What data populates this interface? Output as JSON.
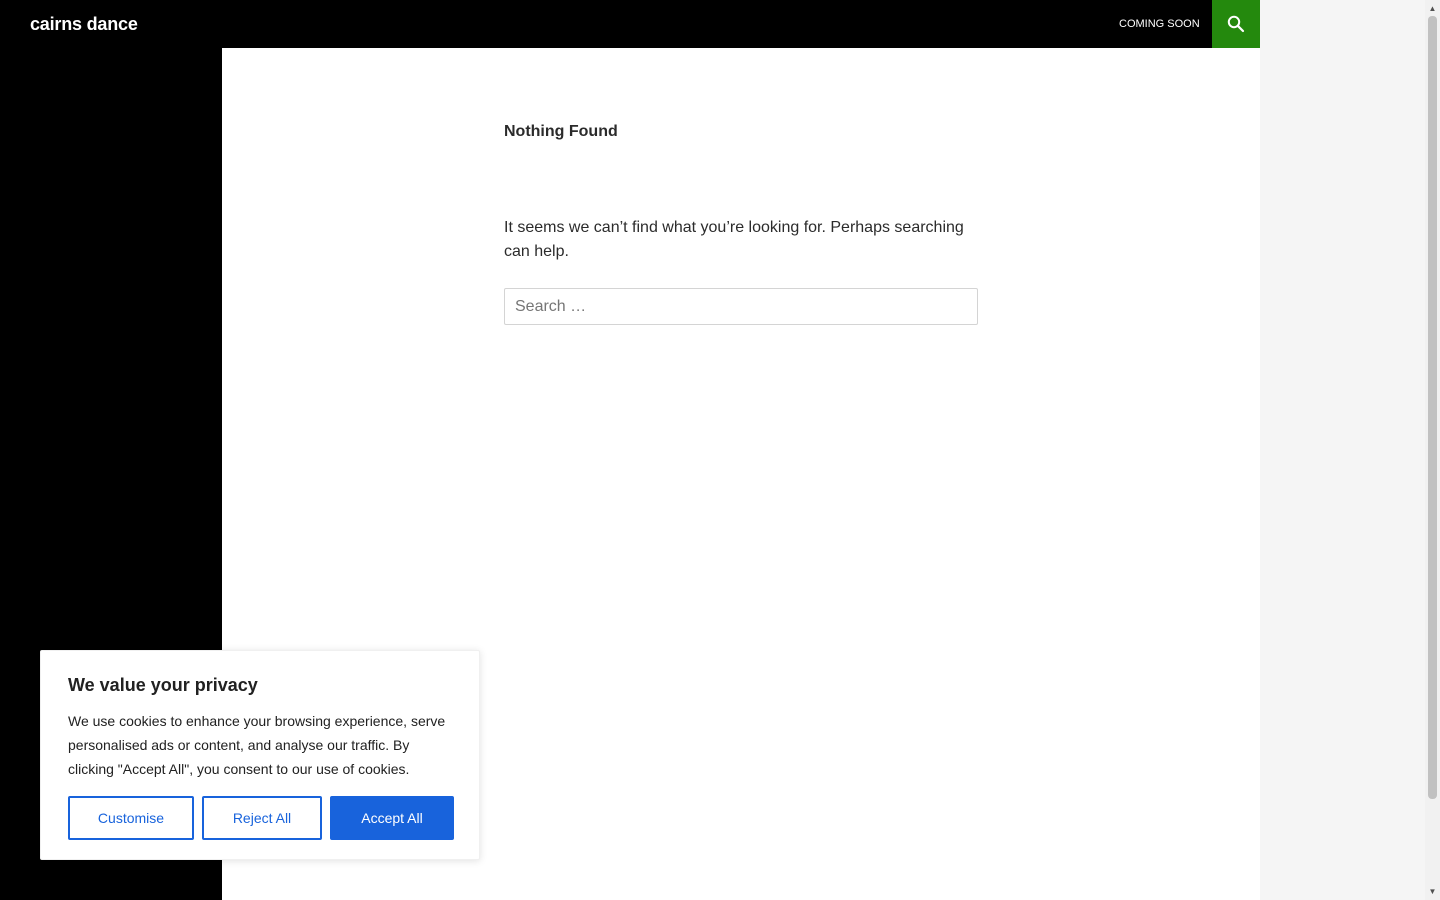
{
  "header": {
    "site_title": "cairns dance",
    "nav_items": [
      {
        "label": "COMING SOON"
      }
    ],
    "search_icon": "search-icon"
  },
  "main": {
    "title": "Nothing Found",
    "message": "It seems we can’t find what you’re looking for. Perhaps searching can help.",
    "search_placeholder": "Search …",
    "search_value": ""
  },
  "cookie_banner": {
    "title": "We value your privacy",
    "text": "We use cookies to enhance your browsing experience, serve personalised ads or content, and analyse our traffic. By clicking \"Accept All\", you consent to our use of cookies.",
    "customise_label": "Customise",
    "reject_label": "Reject All",
    "accept_label": "Accept All"
  },
  "colors": {
    "header_bg": "#000000",
    "accent": "#24890d",
    "cookie_blue": "#1863dc",
    "page_bg": "#f5f5f5"
  }
}
